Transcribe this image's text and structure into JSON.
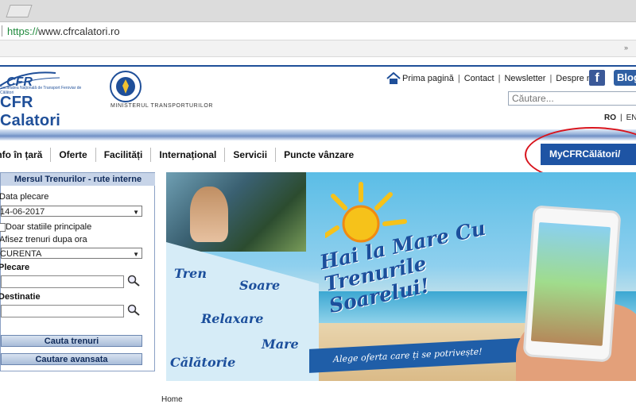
{
  "browser": {
    "url_protocol": "https://",
    "url_rest": "www.cfrcalatori.ro"
  },
  "header": {
    "logo_small": "Societatea Națională de Transport Feroviar de Călători",
    "logo_mark": "CFR",
    "logo_brand": "CFR Calatori",
    "gov_text": "MINISTERUL TRANSPORTURILOR",
    "topnav": [
      "Prima pagină",
      "Contact",
      "Newsletter",
      "Despre noi"
    ],
    "facebook_letter": "f",
    "blog_label": "Blog",
    "search_placeholder": "Căutare...",
    "lang_ro": "RO",
    "lang_en": "EN"
  },
  "mainnav": {
    "items": [
      "Info în țară",
      "Oferte",
      "Facilități",
      "Internațional",
      "Servicii",
      "Puncte vânzare"
    ],
    "login": "MyCFRCălători/ Login"
  },
  "sidebar": {
    "title": "Mersul Trenurilor - rute interne",
    "date_label": "Data plecare",
    "date_value": "14-06-2017",
    "only_main_label": "Doar statiile principale",
    "filter_label": "Afisez trenuri dupa ora",
    "filter_value": "CURENTA",
    "from_label": "Plecare",
    "to_label": "Destinatie",
    "search_btn": "Cauta trenuri",
    "advanced_btn": "Cautare avansata"
  },
  "banner": {
    "words": [
      "Tren",
      "Soare",
      "Relaxare",
      "Mare",
      "Călătorie"
    ],
    "headline": "Hai la Mare Cu Trenurile Soarelui!",
    "offer_text": "Alege oferta care ți se potrivește!"
  },
  "footer": {
    "home": "Home"
  },
  "colors": {
    "brand_blue": "#1e54a4",
    "highlight_red": "#d8141d"
  }
}
